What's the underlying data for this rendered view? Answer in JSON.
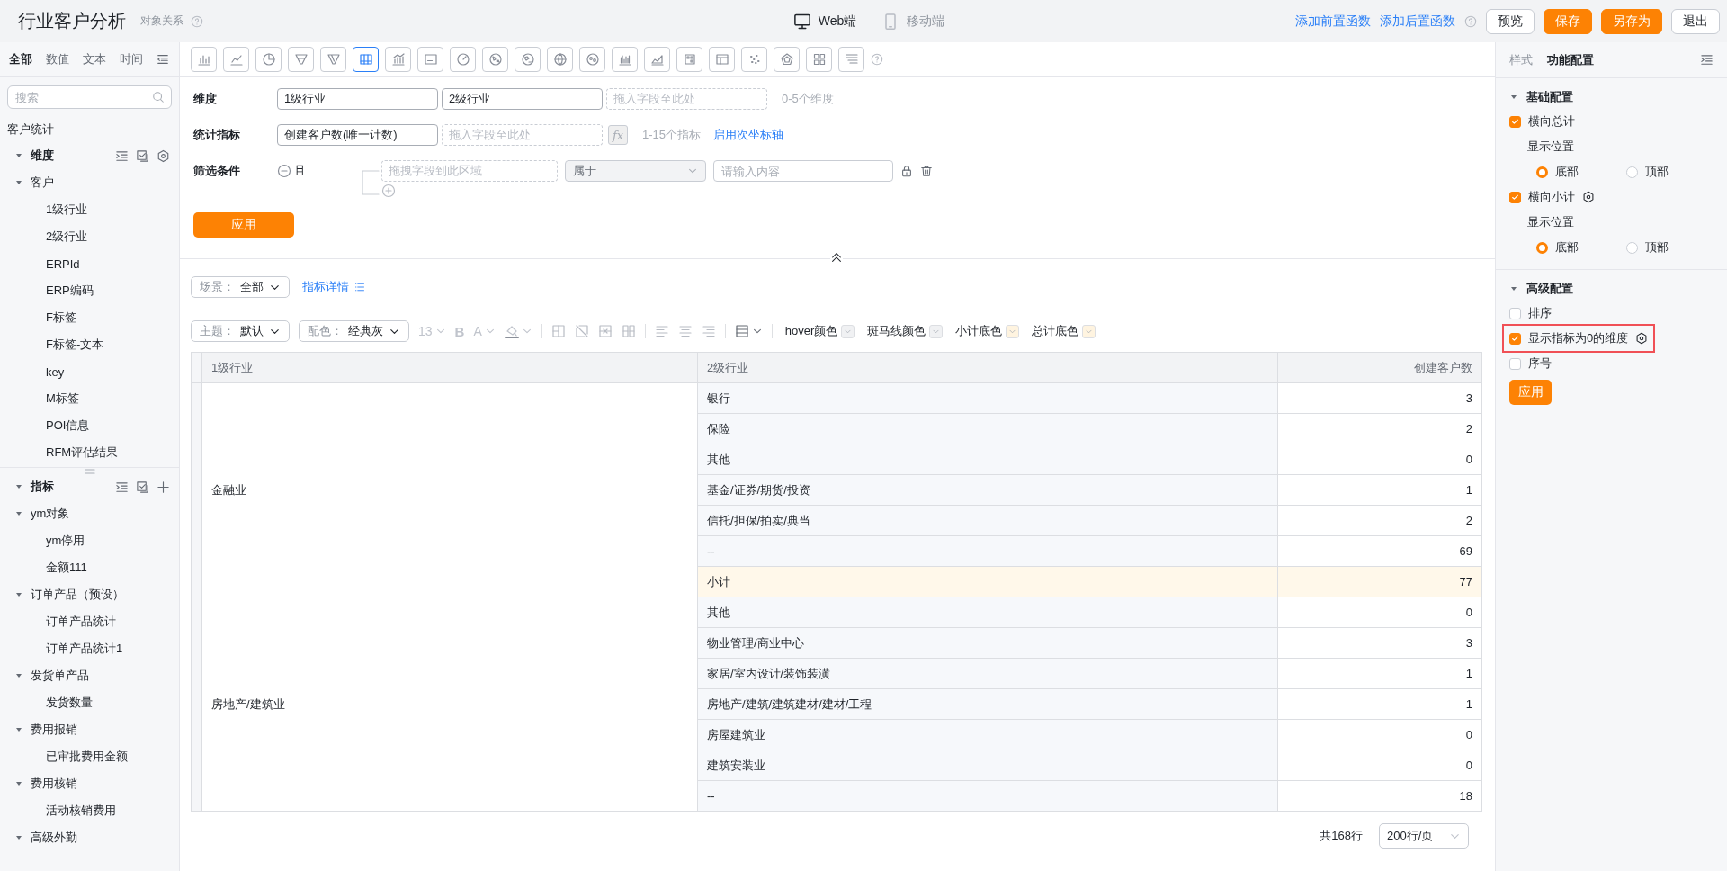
{
  "header": {
    "title": "行业客户分析",
    "subtitle": "对象关系",
    "devices": [
      {
        "kind": "web",
        "label": "Web端",
        "selected": true
      },
      {
        "kind": "mobile",
        "label": "移动端",
        "selected": false
      }
    ],
    "links": [
      "添加前置函数",
      "添加后置函数"
    ],
    "buttons": [
      {
        "kind": "default",
        "label": "预览"
      },
      {
        "kind": "primary",
        "label": "保存"
      },
      {
        "kind": "primary",
        "label": "另存为"
      },
      {
        "kind": "default",
        "label": "退出"
      }
    ]
  },
  "sidebar": {
    "tabs": [
      {
        "label": "全部",
        "selected": true
      },
      {
        "label": "数值",
        "selected": false
      },
      {
        "label": "文本",
        "selected": false
      },
      {
        "label": "时间",
        "selected": false
      }
    ],
    "search": {
      "placeholder": "搜索"
    },
    "group_label": "客户统计",
    "dimension_section": {
      "label": "维度",
      "expanded": true,
      "children": [
        {
          "label": "客户",
          "expanded": true,
          "children": [
            {
              "label": "1级行业"
            },
            {
              "label": "2级行业"
            },
            {
              "label": "ERPId"
            },
            {
              "label": "ERP编码"
            },
            {
              "label": "F标签"
            },
            {
              "label": "F标签-文本"
            },
            {
              "label": "key"
            },
            {
              "label": "M标签"
            },
            {
              "label": "POI信息"
            },
            {
              "label": "RFM评估结果"
            }
          ]
        }
      ]
    },
    "metric_section": {
      "label": "指标",
      "expanded": true,
      "children": [
        {
          "label": "ym对象",
          "expanded": true,
          "children": [
            {
              "label": "ym停用"
            },
            {
              "label": "金额111"
            }
          ]
        },
        {
          "label": "订单产品（预设）",
          "expanded": true,
          "children": [
            {
              "label": "订单产品统计"
            },
            {
              "label": "订单产品统计1"
            }
          ]
        },
        {
          "label": "发货单产品",
          "expanded": true,
          "children": [
            {
              "label": "发货数量"
            }
          ]
        },
        {
          "label": "费用报销",
          "expanded": true,
          "children": [
            {
              "label": "已审批费用金额"
            }
          ]
        },
        {
          "label": "费用核销",
          "expanded": true,
          "children": [
            {
              "label": "活动核销费用"
            }
          ]
        },
        {
          "label": "高级外勤",
          "expanded": true
        }
      ]
    }
  },
  "chart_types": [
    {
      "kind": "bar",
      "selected": false
    },
    {
      "kind": "line",
      "selected": false
    },
    {
      "kind": "pie",
      "selected": false
    },
    {
      "kind": "funnel",
      "selected": false
    },
    {
      "kind": "funnel2",
      "selected": false
    },
    {
      "kind": "table",
      "selected": true
    },
    {
      "kind": "combo",
      "selected": false
    },
    {
      "kind": "card",
      "selected": false
    },
    {
      "kind": "gauge",
      "selected": false
    },
    {
      "kind": "map",
      "selected": false
    },
    {
      "kind": "map2",
      "selected": false
    },
    {
      "kind": "world",
      "selected": false
    },
    {
      "kind": "bubble",
      "selected": false
    },
    {
      "kind": "bars",
      "selected": false
    },
    {
      "kind": "area",
      "selected": false
    },
    {
      "kind": "heatmap",
      "selected": false
    },
    {
      "kind": "pivot",
      "selected": false
    },
    {
      "kind": "scatter",
      "selected": false
    },
    {
      "kind": "radar",
      "selected": false
    },
    {
      "kind": "grid",
      "selected": false
    },
    {
      "kind": "tree",
      "selected": false
    }
  ],
  "config": {
    "dimension": {
      "label": "维度",
      "fields": [
        "1级行业",
        "2级行业"
      ],
      "drop_placeholder": "拖入字段至此处",
      "hint": "0-5个维度"
    },
    "metric": {
      "label": "统计指标",
      "fields": [
        "创建客户数(唯一计数)"
      ],
      "drop_placeholder": "拖入字段至此处",
      "formula": "fx",
      "hint": "1-15个指标",
      "link": "启用次坐标轴"
    },
    "filter": {
      "label": "筛选条件",
      "logic": "且",
      "field_placeholder": "拖拽字段到此区域",
      "operator": "属于",
      "value_placeholder": "请输入内容"
    },
    "apply": "应用"
  },
  "scene": {
    "label": "场景：",
    "value": "全部",
    "detail_link": "指标详情"
  },
  "format_toolbar": {
    "selects": [
      {
        "label": "主题：",
        "value": "默认"
      },
      {
        "label": "配色：",
        "value": "经典灰"
      }
    ],
    "font_tools_disabled": true,
    "font_size": "13",
    "bold": "B",
    "font_color": "A",
    "color_pickers": [
      {
        "label": "hover颜色",
        "color": "#f0f1f3"
      },
      {
        "label": "斑马线颜色",
        "color": "#f0f1f3"
      },
      {
        "label": "小计底色",
        "color": "#fff4e0"
      },
      {
        "label": "总计底色",
        "color": "#fff4e0"
      }
    ]
  },
  "table": {
    "columns": [
      "1级行业",
      "2级行业",
      "创建客户数"
    ],
    "groups": [
      {
        "name": "金融业",
        "rows": [
          {
            "kind": "row",
            "name": "银行",
            "value": "3"
          },
          {
            "kind": "row",
            "name": "保险",
            "value": "2"
          },
          {
            "kind": "row",
            "name": "其他",
            "value": "0"
          },
          {
            "kind": "row",
            "name": "基金/证券/期货/投资",
            "value": "1"
          },
          {
            "kind": "row",
            "name": "信托/担保/拍卖/典当",
            "value": "2"
          },
          {
            "kind": "row",
            "name": "--",
            "value": "69"
          },
          {
            "kind": "subtotal",
            "name": "小计",
            "value": "77"
          }
        ]
      },
      {
        "name": "房地产/建筑业",
        "rows": [
          {
            "kind": "row",
            "name": "其他",
            "value": "0"
          },
          {
            "kind": "row",
            "name": "物业管理/商业中心",
            "value": "3"
          },
          {
            "kind": "row",
            "name": "家居/室内设计/装饰装潢",
            "value": "1"
          },
          {
            "kind": "row",
            "name": "房地产/建筑/建筑建材/建材/工程",
            "value": "1"
          },
          {
            "kind": "row",
            "name": "房屋建筑业",
            "value": "0"
          },
          {
            "kind": "row",
            "name": "建筑安装业",
            "value": "0"
          },
          {
            "kind": "row",
            "name": "--",
            "value": "18"
          }
        ]
      }
    ]
  },
  "pagination": {
    "total": "共168行",
    "page_size": "200行/页"
  },
  "right_panel": {
    "tabs": [
      {
        "label": "样式",
        "selected": false
      },
      {
        "label": "功能配置",
        "selected": true
      }
    ],
    "sections": [
      {
        "title": "基础配置",
        "expanded": true,
        "items": [
          {
            "kind": "checkbox",
            "label": "横向总计",
            "checked": true
          },
          {
            "kind": "label",
            "label": "显示位置"
          },
          {
            "kind": "radio",
            "options": [
              {
                "label": "底部",
                "selected": true
              },
              {
                "label": "顶部",
                "selected": false
              }
            ]
          },
          {
            "kind": "checkbox",
            "label": "横向小计",
            "checked": true,
            "settings": true
          },
          {
            "kind": "label",
            "label": "显示位置"
          },
          {
            "kind": "radio",
            "options": [
              {
                "label": "底部",
                "selected": true
              },
              {
                "label": "顶部",
                "selected": false
              }
            ]
          }
        ]
      },
      {
        "title": "高级配置",
        "expanded": true,
        "items": [
          {
            "kind": "checkbox",
            "label": "排序",
            "checked": false
          },
          {
            "kind": "checkbox",
            "label": "显示指标为0的维度",
            "checked": true,
            "settings": true,
            "highlighted": true
          },
          {
            "kind": "checkbox",
            "label": "序号",
            "checked": false
          },
          {
            "kind": "button",
            "label": "应用"
          }
        ]
      }
    ]
  }
}
